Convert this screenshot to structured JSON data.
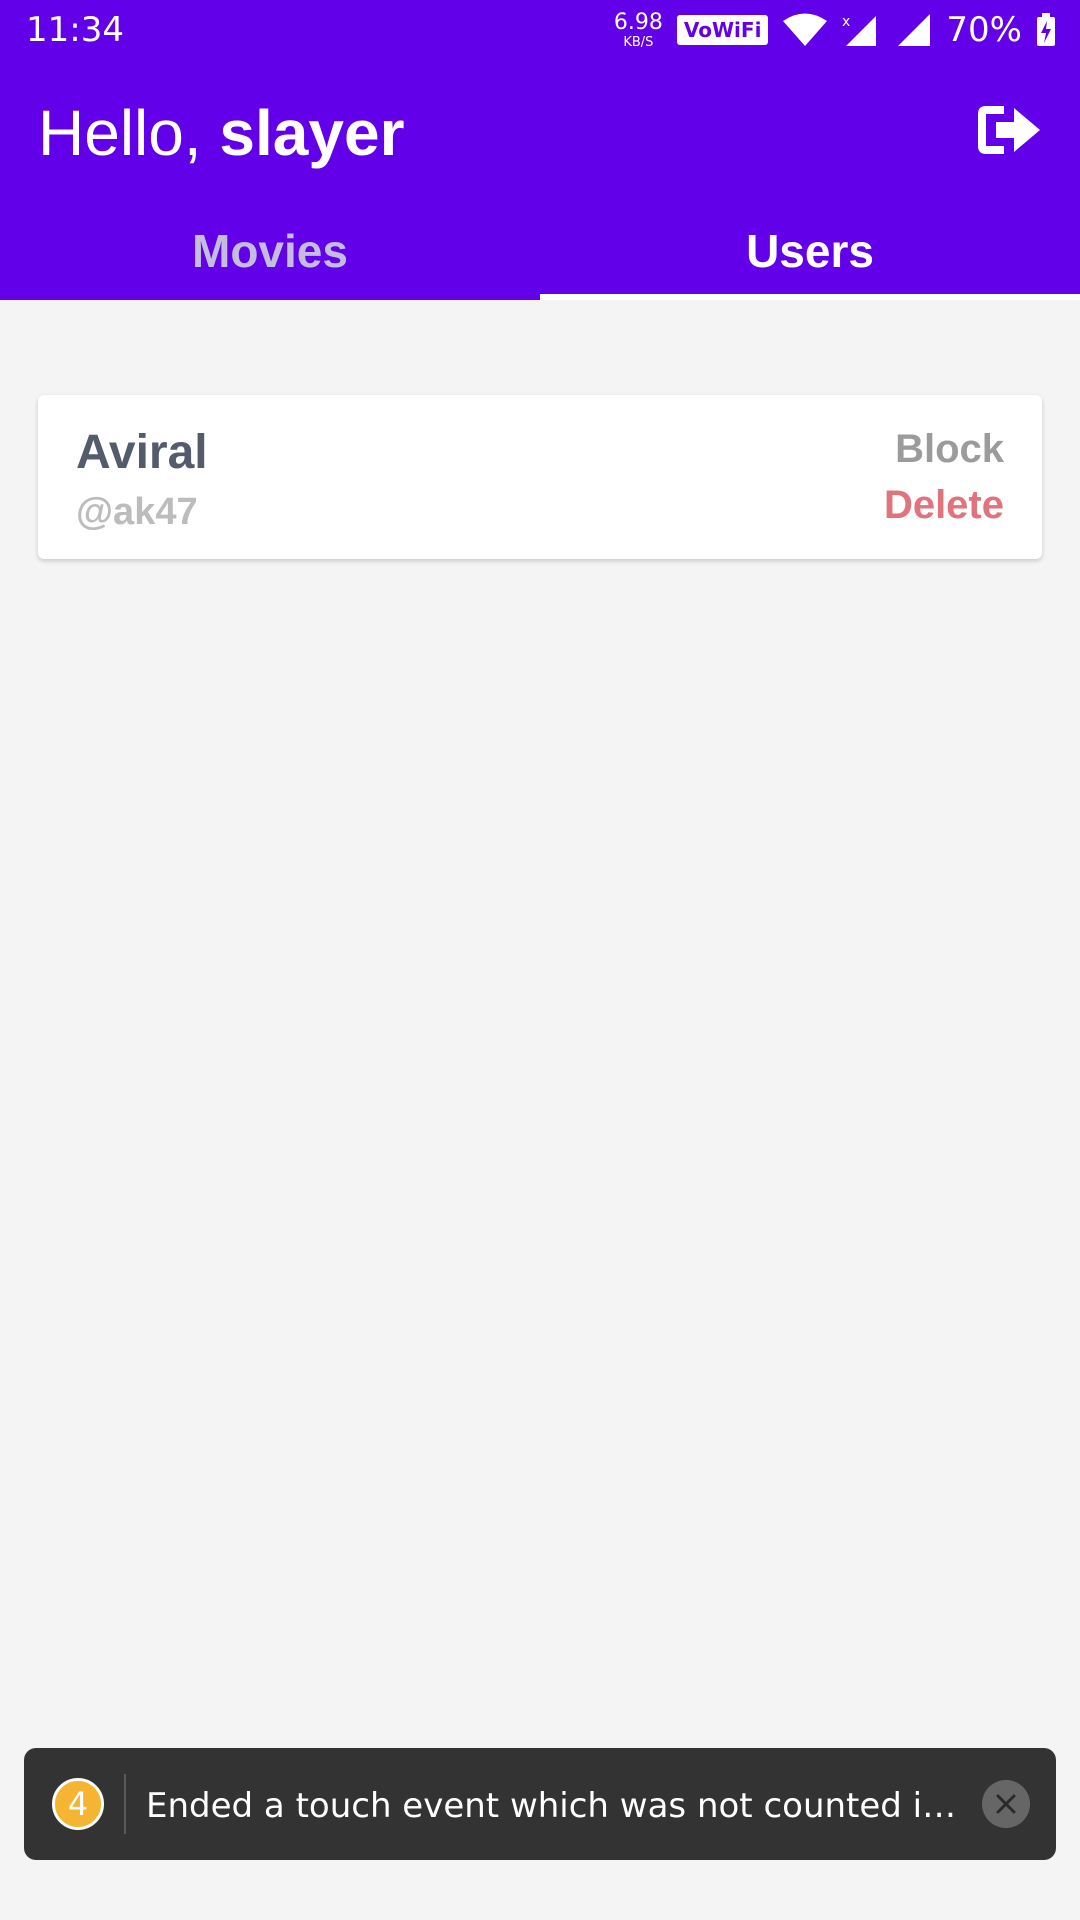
{
  "status_bar": {
    "time": "11:34",
    "net_speed_value": "6.98",
    "net_speed_unit": "KB/S",
    "vowifi_label": "VoWiFi",
    "battery_percent": "70%"
  },
  "header": {
    "greeting_prefix": "Hello,",
    "username": "slayer",
    "logout_icon": "logout-icon"
  },
  "tabs": [
    {
      "label": "Movies",
      "active": false
    },
    {
      "label": "Users",
      "active": true
    }
  ],
  "users": [
    {
      "name": "Aviral",
      "handle": "@ak47",
      "block_label": "Block",
      "delete_label": "Delete"
    }
  ],
  "toast": {
    "count": "4",
    "message": "Ended a touch event which was not counted in `trac..."
  },
  "colors": {
    "primary": "#6200ea",
    "background": "#f4f4f4",
    "delete": "#e0737c",
    "block": "#9b9b9b",
    "toast_badge": "#f5b432"
  }
}
